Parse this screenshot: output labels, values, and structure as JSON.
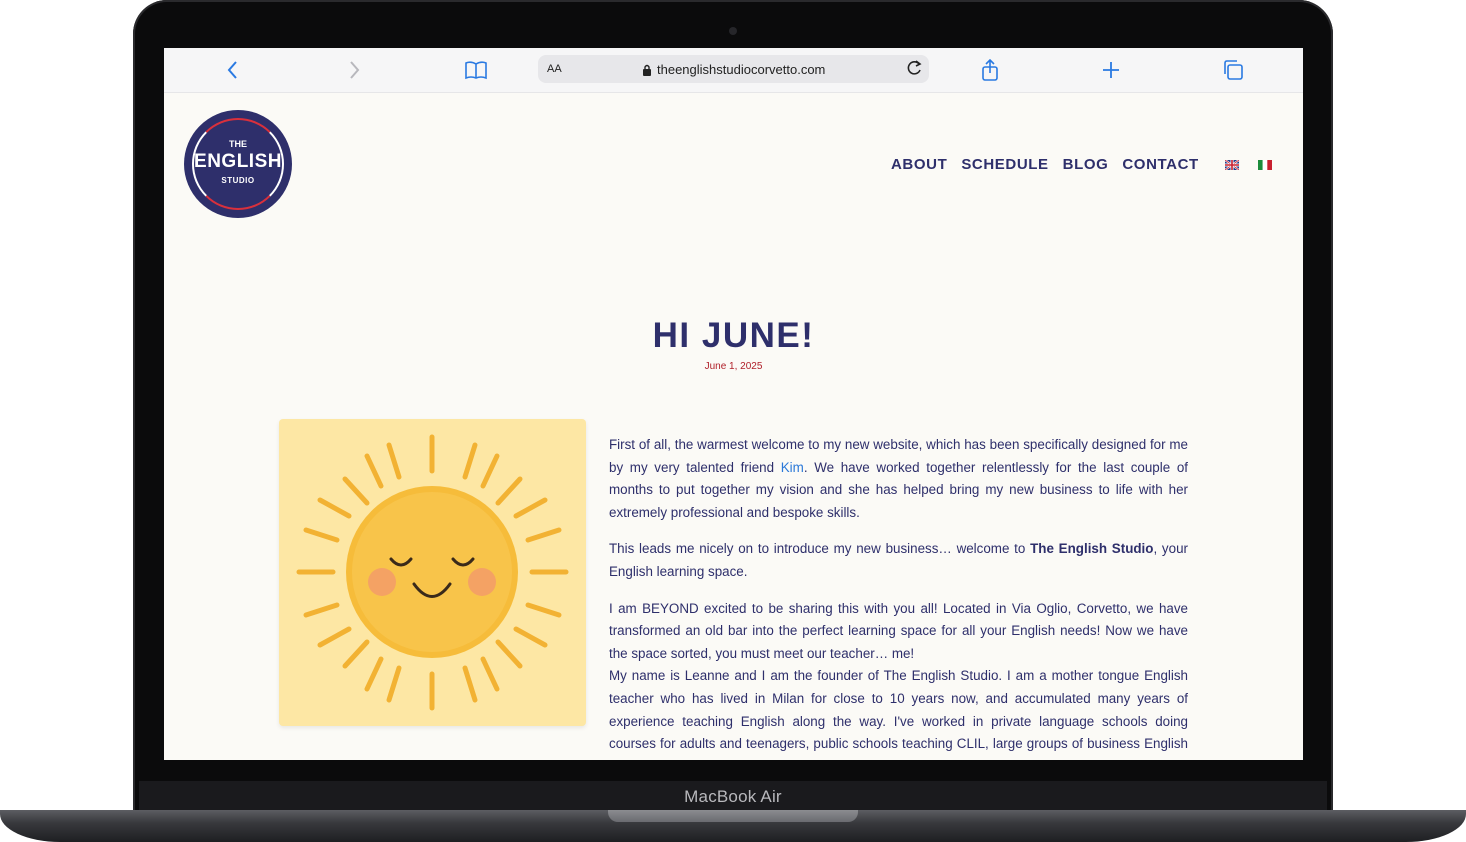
{
  "device": {
    "label": "MacBook Air"
  },
  "browser": {
    "reader_label": "AA",
    "url": "theenglishstudiocorvetto.com",
    "icons": [
      "back-icon",
      "forward-icon",
      "bookmarks-icon",
      "lock-icon",
      "reload-icon",
      "share-icon",
      "new-tab-icon",
      "tabs-icon"
    ]
  },
  "site": {
    "logo": {
      "line1": "THE",
      "line2": "ENGLISH",
      "line3": "STUDIO"
    },
    "nav": [
      {
        "label": "ABOUT"
      },
      {
        "label": "SCHEDULE"
      },
      {
        "label": "BLOG"
      },
      {
        "label": "CONTACT"
      }
    ],
    "languages": [
      "en-flag-icon",
      "it-flag-icon"
    ],
    "colors": {
      "brand": "#2e2f6b",
      "accent": "#b0202a",
      "link": "#2a78d8",
      "background": "#fbfaf6"
    }
  },
  "article": {
    "title": "HI JUNE!",
    "date": "June 1, 2025",
    "image": "smiling-sun-illustration",
    "p1_a": "First of all, the warmest welcome to my new website, which has been specifically designed for me by my very talented friend ",
    "p1_link": "Kim",
    "p1_b": ". We have worked together relentlessly for the last couple of months to put together my vision and she has helped bring my new business to life with her extremely professional and bespoke skills.",
    "p2_a": "This leads me nicely on to introduce my new business… welcome to ",
    "p2_bold": "The English Studio",
    "p2_b": ", your English learning space.",
    "p3": "I am BEYOND excited to be sharing this with you all! Located in Via Oglio, Corvetto, we have transformed an old bar into the perfect learning space for all your English needs! Now we have the space sorted, you must meet our teacher… me!",
    "p4": "My name is Leanne and I am the founder of The English Studio. I am a mother tongue English teacher who has lived in Milan for close to 10 years now, and accumulated many years of experience teaching English along the way. I've worked in private language schools doing courses for adults and teenagers, public schools teaching CLIL, large groups of business English for MNC's,"
  }
}
